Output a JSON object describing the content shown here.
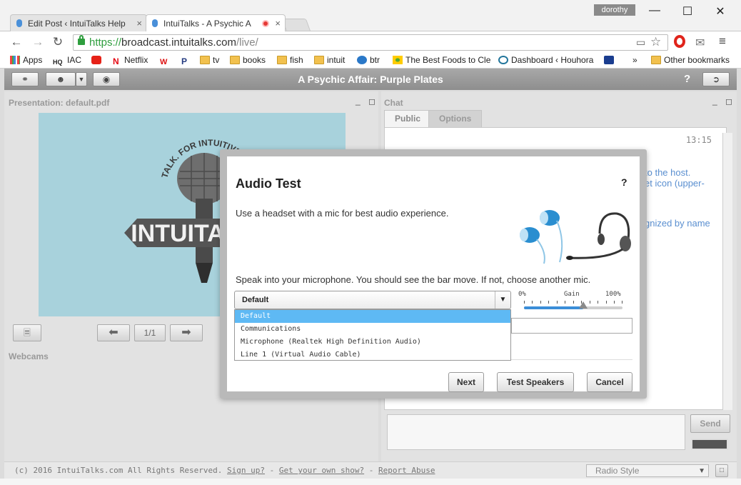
{
  "browser": {
    "tabs": [
      {
        "title": "Edit Post ‹ IntuiTalks Help",
        "close": "×"
      },
      {
        "title": "IntuiTalks - A Psychic A",
        "close": "×"
      }
    ],
    "user": "dorothy",
    "window_controls": [
      "—",
      "☐",
      "✕"
    ],
    "url_scheme": "https://",
    "url_host": "broadcast.intuitalks.com",
    "url_path": "/live/",
    "bookmarks": [
      {
        "label": "Apps",
        "icon": "apps-grid-icon"
      },
      {
        "label": "IAC",
        "icon": "hq-icon"
      },
      {
        "label": "",
        "icon": "youtube-icon"
      },
      {
        "label": "Netflix",
        "icon": "netflix-icon"
      },
      {
        "label": "",
        "icon": "w-icon"
      },
      {
        "label": "",
        "icon": "paypal-icon"
      },
      {
        "label": "tv",
        "icon": "folder-icon"
      },
      {
        "label": "books",
        "icon": "folder-icon"
      },
      {
        "label": "fish",
        "icon": "folder-icon"
      },
      {
        "label": "intuit",
        "icon": "folder-icon"
      },
      {
        "label": "btr",
        "icon": "btr-icon"
      },
      {
        "label": "The Best Foods to Cle",
        "icon": "sunflower-icon"
      },
      {
        "label": "Dashboard ‹ Houhora",
        "icon": "wordpress-icon"
      },
      {
        "label": "",
        "icon": "checkbox-icon"
      }
    ],
    "bookmarks_overflow": "»",
    "other_bookmarks": "Other bookmarks"
  },
  "app": {
    "title": "A Psychic Affair: Purple Plates",
    "help": "?"
  },
  "presentation": {
    "title": "Presentation: default.pdf",
    "page": "1/1",
    "logo_top_text": "TALK. FOR INTUITIVES",
    "logo_text": "INTUITALKS"
  },
  "webcams": {
    "title": "Webcams"
  },
  "chat": {
    "title": "Chat",
    "tabs": [
      "Public",
      "Options"
    ],
    "time": "13:15",
    "lines": [
      "to the host.",
      "et icon (upper-",
      ".",
      "gnized by name"
    ],
    "send_label": "Send"
  },
  "footer": {
    "copyright": "(c) 2016 IntuiTalks.com All Rights Reserved.",
    "links": [
      "Sign up?",
      "Get your own show?",
      "Report Abuse"
    ],
    "style_select": "Radio Style"
  },
  "modal": {
    "title": "Audio Test",
    "help": "?",
    "headset_hint": "Use a headset with a mic for best audio experience.",
    "instruction": "Speak into your microphone. You should see the bar move. If not, choose another mic.",
    "selected_device": "Default",
    "devices": [
      "Default",
      "Communications",
      "Microphone (Realtek High Definition Audio)",
      "Line 1 (Virtual Audio Cable)"
    ],
    "gain": {
      "min_label": "0%",
      "label": "Gain",
      "max_label": "100%",
      "value_percent": 60
    },
    "buttons": {
      "next": "Next",
      "test_speakers": "Test Speakers",
      "cancel": "Cancel"
    }
  },
  "colors": {
    "accent": "#5eb9f4",
    "header": "#9a9a9a",
    "link": "#5a8fd0"
  }
}
